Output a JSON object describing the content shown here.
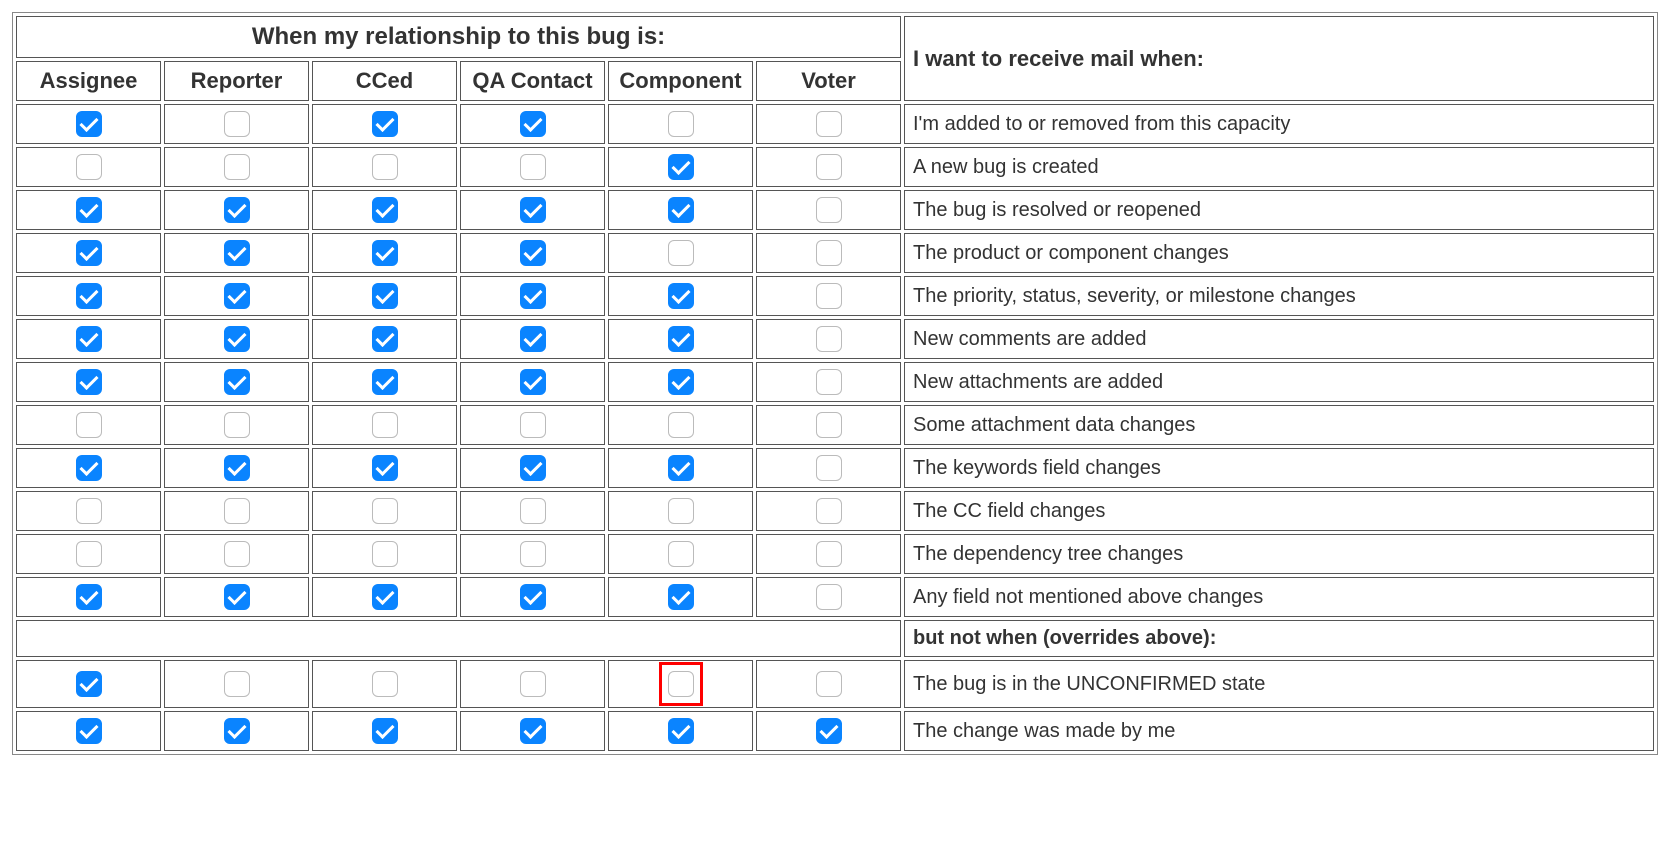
{
  "headers": {
    "relationship": "When my relationship to this bug is:",
    "mailWhen": "I want to receive mail when:",
    "butNot": "but not when (overrides above):"
  },
  "columns": [
    "Assignee",
    "Reporter",
    "CCed",
    "QA Contact",
    "Component",
    "Voter"
  ],
  "rows": [
    {
      "label": "I'm added to or removed from this capacity",
      "checks": [
        true,
        false,
        true,
        true,
        false,
        false
      ]
    },
    {
      "label": "A new bug is created",
      "checks": [
        false,
        false,
        false,
        false,
        true,
        false
      ]
    },
    {
      "label": "The bug is resolved or reopened",
      "checks": [
        true,
        true,
        true,
        true,
        true,
        false
      ]
    },
    {
      "label": "The product or component changes",
      "checks": [
        true,
        true,
        true,
        true,
        false,
        false
      ]
    },
    {
      "label": "The priority, status, severity, or milestone changes",
      "checks": [
        true,
        true,
        true,
        true,
        true,
        false
      ]
    },
    {
      "label": "New comments are added",
      "checks": [
        true,
        true,
        true,
        true,
        true,
        false
      ]
    },
    {
      "label": "New attachments are added",
      "checks": [
        true,
        true,
        true,
        true,
        true,
        false
      ]
    },
    {
      "label": "Some attachment data changes",
      "checks": [
        false,
        false,
        false,
        false,
        false,
        false
      ]
    },
    {
      "label": "The keywords field changes",
      "checks": [
        true,
        true,
        true,
        true,
        true,
        false
      ]
    },
    {
      "label": "The CC field changes",
      "checks": [
        false,
        false,
        false,
        false,
        false,
        false
      ]
    },
    {
      "label": "The dependency tree changes",
      "checks": [
        false,
        false,
        false,
        false,
        false,
        false
      ]
    },
    {
      "label": "Any field not mentioned above changes",
      "checks": [
        true,
        true,
        true,
        true,
        true,
        false
      ]
    }
  ],
  "overrideRows": [
    {
      "label": "The bug is in the UNCONFIRMED state",
      "checks": [
        true,
        false,
        false,
        false,
        false,
        false
      ],
      "highlightIndex": 4
    },
    {
      "label": "The change was made by me",
      "checks": [
        true,
        true,
        true,
        true,
        true,
        true
      ]
    }
  ]
}
